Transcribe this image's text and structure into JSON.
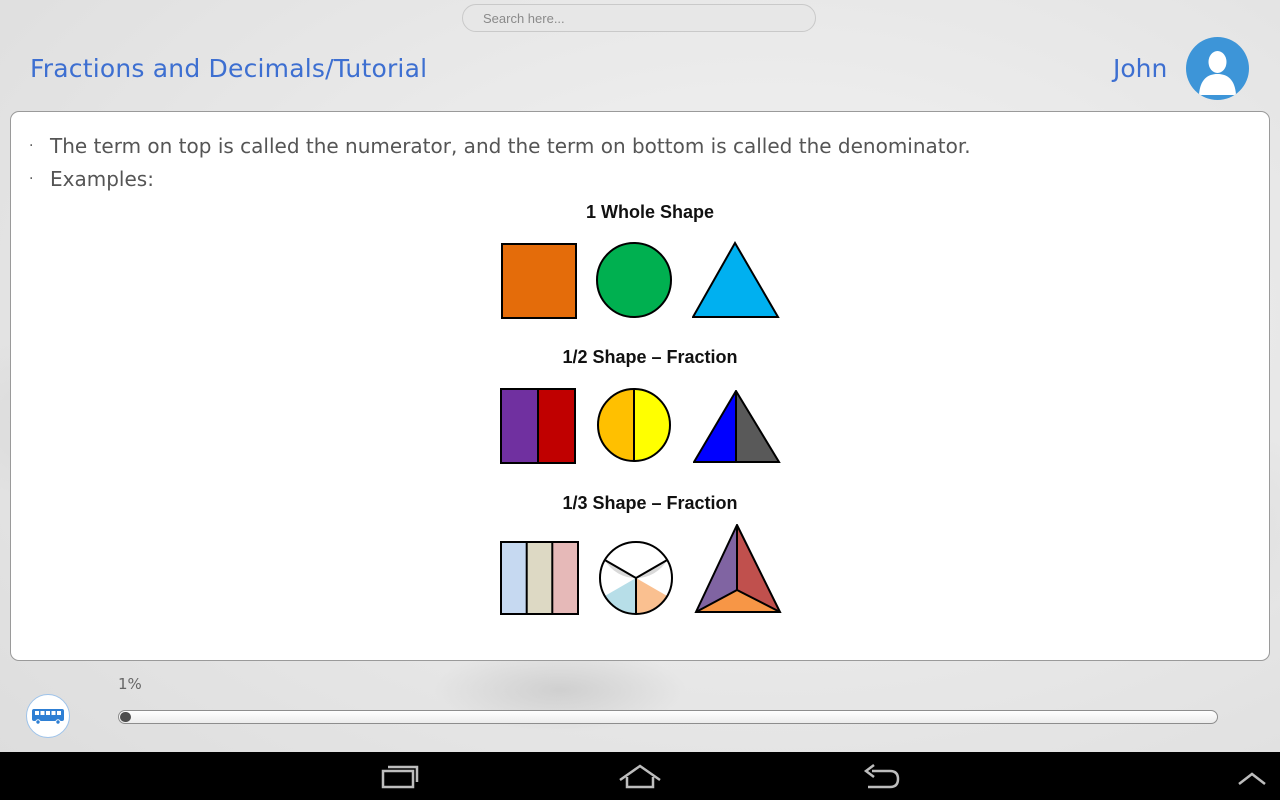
{
  "search": {
    "placeholder": "Search here..."
  },
  "header": {
    "title": "Fractions and Decimals/Tutorial",
    "user_name": "John"
  },
  "content": {
    "bullets": [
      "The term on top is called the numerator, and the term on bottom is called the denominator.",
      "Examples:"
    ],
    "figure": {
      "sections": [
        {
          "title": "1 Whole Shape",
          "shapes": [
            "square-whole",
            "circle-whole",
            "triangle-whole"
          ]
        },
        {
          "title": "1/2 Shape – Fraction",
          "shapes": [
            "square-halves",
            "circle-halves",
            "triangle-halves"
          ]
        },
        {
          "title": "1/3 Shape – Fraction",
          "shapes": [
            "square-thirds",
            "circle-thirds",
            "triangle-thirds"
          ]
        }
      ],
      "colors": {
        "whole": [
          "#e46c0a",
          "#00b050",
          "#00b0f0"
        ],
        "halves_square": [
          "#7030a0",
          "#c00000"
        ],
        "halves_circle": [
          "#ffc000",
          "#ffff00"
        ],
        "halves_triangle": [
          "#0000ff",
          "#595959"
        ],
        "thirds_square": [
          "#c6d9f1",
          "#ddd9c4",
          "#e6b9b8"
        ],
        "thirds_circle": [
          "#d9d9d9",
          "#b7dee8",
          "#fac090"
        ],
        "thirds_triangle": [
          "#8064a2",
          "#c0504d",
          "#f79646"
        ]
      }
    }
  },
  "progress": {
    "label": "1%",
    "value": 0.01
  },
  "footer": {
    "bus_icon": "bus-icon"
  },
  "navbar": {
    "icons": [
      "recent-apps-icon",
      "home-icon",
      "back-icon",
      "chevron-up-icon"
    ]
  }
}
